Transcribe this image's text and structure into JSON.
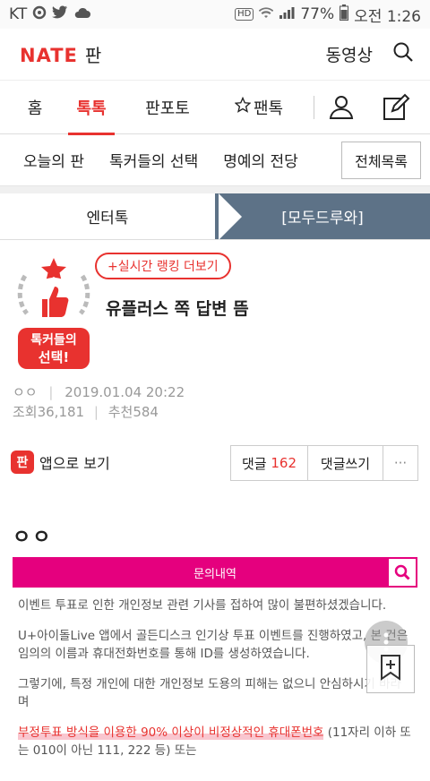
{
  "status": {
    "carrier": "KT",
    "battery": "77%",
    "time": "오전 1:26",
    "hd": "HD"
  },
  "header": {
    "logo_brand": "NATE",
    "logo_suffix": "판",
    "video_link": "동영상"
  },
  "nav": {
    "tabs": [
      "홈",
      "톡톡",
      "판포토",
      "팬톡"
    ]
  },
  "subnav": {
    "items": [
      "오늘의 판",
      "톡커들의 선택",
      "명예의 전당"
    ],
    "all_button": "전체목록"
  },
  "category": {
    "left": "엔터톡",
    "right": "[모두드루와]"
  },
  "article": {
    "badge_line1": "톡커들의",
    "badge_line2": "선택!",
    "rank_link": "+실시간 랭킹 더보기",
    "title": "유플러스 쪽 답변 뜸",
    "author": "ㅇㅇ",
    "date": "2019.01.04 20:22",
    "views": "조회36,181",
    "recommends": "추천584"
  },
  "actions": {
    "app_icon_text": "판",
    "app_view": "앱으로 보기",
    "comments_label": "댓글",
    "comments_count": "162",
    "write_comment": "댓글쓰기",
    "more": "···"
  },
  "content": {
    "heading": "ㅇㅇ",
    "inquiry_bar": "문의내역",
    "para1": "이벤트 투표로 인한 개인정보 관련 기사를 접하여 많이 불편하셨겠습니다.",
    "para2": "U+아이돌Live 앱에서 골든디스크 인기상 투표 이벤트를 진행하였고, 본 건은 임의의 이름과 휴대전화번호를 통해 ID를 생성하였습니다.",
    "para3": "그렇기에, 특정 개인에 대한 개인정보 도용의 피해는 없으니 안심하시기 바라며",
    "para4_highlight": "부정투표 방식을 이용한 90% 이상이 비정상적인 휴대폰번호",
    "para4_rest": " (11자리 이하 또는 010이 아닌 111, 222 등) 또는"
  },
  "colors": {
    "accent": "#e8322f",
    "category_dark": "#5d7287",
    "inquiry_magenta": "#e5007e"
  }
}
